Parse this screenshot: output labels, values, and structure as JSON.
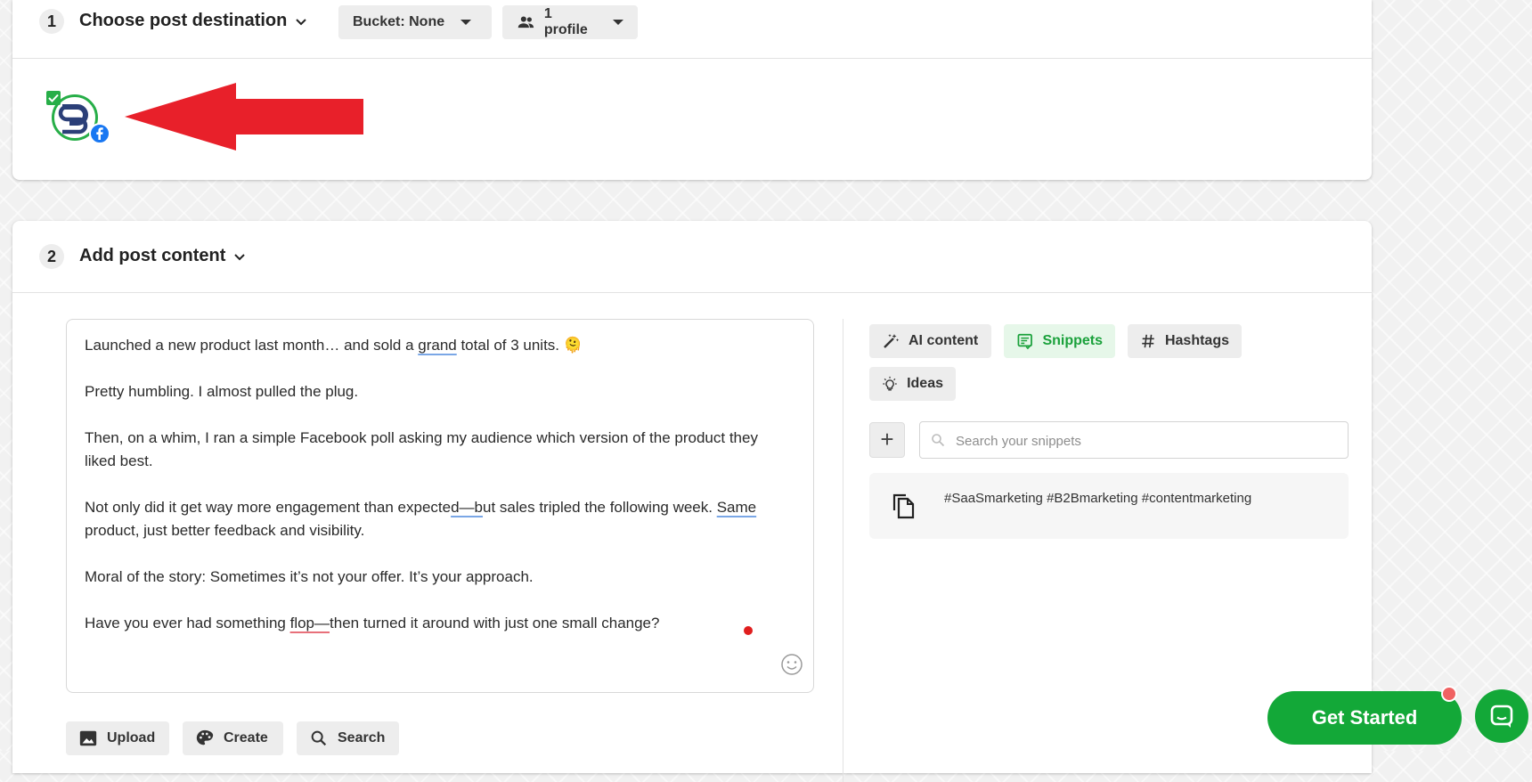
{
  "step1": {
    "number": "1",
    "title": "Choose post destination",
    "bucket_label": "Bucket: None",
    "profile_label": "1 profile"
  },
  "step2": {
    "number": "2",
    "title": "Add post content",
    "post_lines": [
      "Launched a new product last month… and sold a ",
      "grand",
      " total of 3 units. 🫠",
      "Pretty humbling. I almost pulled the plug.",
      "Then, on a whim, I ran a simple Facebook poll asking my audience which version of the product they liked best.",
      "Not only did it get way more engagement than expecte",
      "d—b",
      "ut sales tripled the following week. ",
      "Same",
      " product, just better feedback and visibility.",
      "Moral of the story: Sometimes it’s not your offer. It’s your approach.",
      "Have you ever had something ",
      "flop—",
      "then turned it around with just one small change?"
    ],
    "media_buttons": {
      "upload": "Upload",
      "create": "Create",
      "search": "Search"
    },
    "tools": {
      "ai_content": "AI content",
      "snippets": "Snippets",
      "hashtags": "Hashtags",
      "ideas": "Ideas"
    },
    "snippet_search_placeholder": "Search your snippets",
    "snippet_text": "#SaaSmarketing #B2Bmarketing #contentmarketing"
  },
  "cta": {
    "get_started": "Get Started"
  },
  "icons": [
    "chevron-down-icon",
    "people-icon",
    "check-icon",
    "facebook-icon",
    "emoji-icon",
    "image-icon",
    "palette-icon",
    "search-icon",
    "magic-wand-icon",
    "snippet-icon",
    "hashtag-icon",
    "lightbulb-icon",
    "plus-icon",
    "copy-icon",
    "chat-icon"
  ],
  "colors": {
    "brand_green": "#13a838",
    "active_tab_bg": "#e6f7e9",
    "facebook_blue": "#1877f2",
    "arrow_red": "#e8202a"
  }
}
